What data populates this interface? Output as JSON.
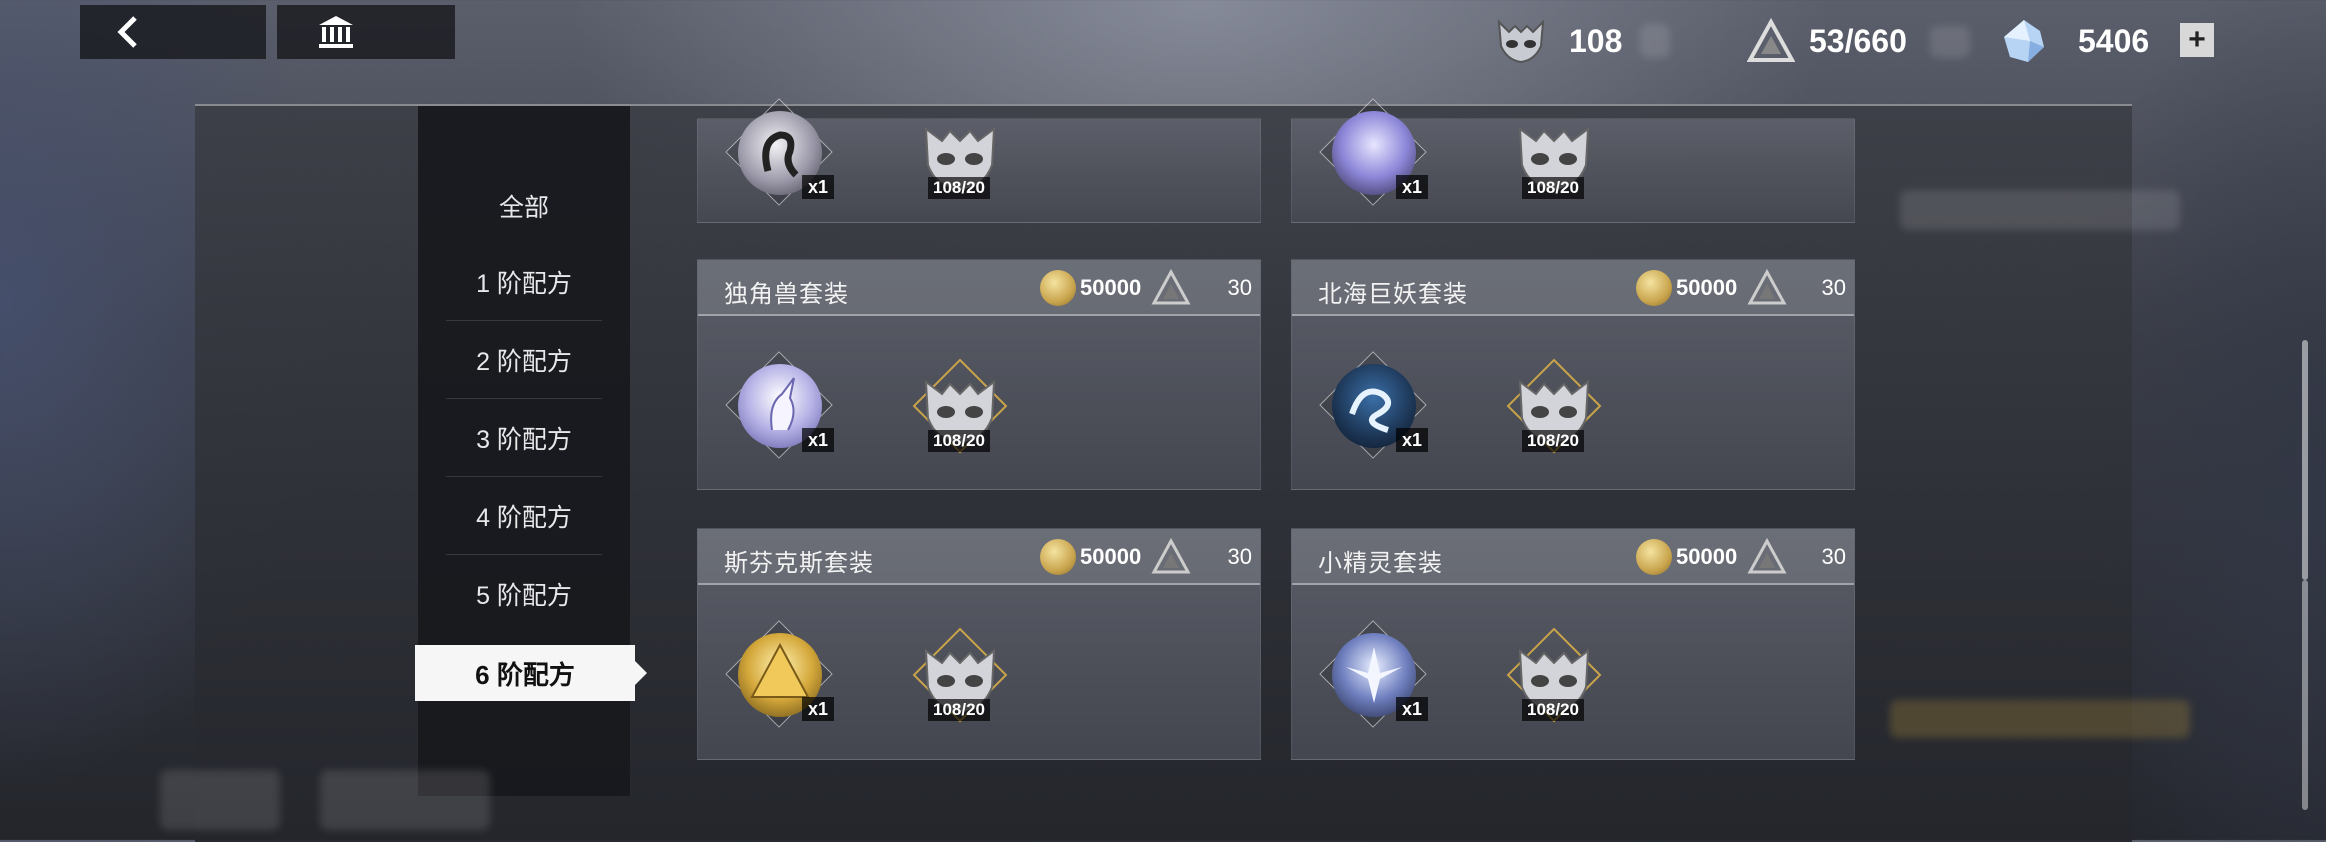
{
  "top_bar": {
    "back_icon": "chevron-left-icon",
    "bank_icon": "bank-icon",
    "resources": [
      {
        "icon": "mask-icon",
        "value": "108"
      },
      {
        "icon": "triangle-icon",
        "value": "53/660"
      },
      {
        "icon": "crystal-icon",
        "value": "5406"
      }
    ],
    "add_label": "+"
  },
  "sidebar": {
    "items": [
      {
        "label": "全部"
      },
      {
        "label": "1 阶配方"
      },
      {
        "label": "2 阶配方"
      },
      {
        "label": "3 阶配方"
      },
      {
        "label": "4 阶配方"
      },
      {
        "label": "5 阶配方"
      },
      {
        "label": "6 阶配方"
      }
    ],
    "active_index": 6
  },
  "cards": [
    {
      "title": "",
      "coin": "",
      "tri": "",
      "qty": "x1",
      "mask_count": "108/20",
      "orb": "swan"
    },
    {
      "title": "",
      "coin": "",
      "tri": "",
      "qty": "x1",
      "mask_count": "108/20",
      "orb": "violet"
    },
    {
      "title": "独角兽套装",
      "coin": "50000",
      "tri": "30",
      "qty": "x1",
      "mask_count": "108/20",
      "orb": "unicorn"
    },
    {
      "title": "北海巨妖套装",
      "coin": "50000",
      "tri": "30",
      "qty": "x1",
      "mask_count": "108/20",
      "orb": "kraken"
    },
    {
      "title": "斯芬克斯套装",
      "coin": "50000",
      "tri": "30",
      "qty": "x1",
      "mask_count": "108/20",
      "orb": "sphinx"
    },
    {
      "title": "小精灵套装",
      "coin": "50000",
      "tri": "30",
      "qty": "x1",
      "mask_count": "108/20",
      "orb": "fairy"
    }
  ],
  "colors": {
    "panel": "#3c3e46",
    "sidebar": "#18191d",
    "active": "#f6f6f6",
    "coin": "#c9a54e"
  }
}
